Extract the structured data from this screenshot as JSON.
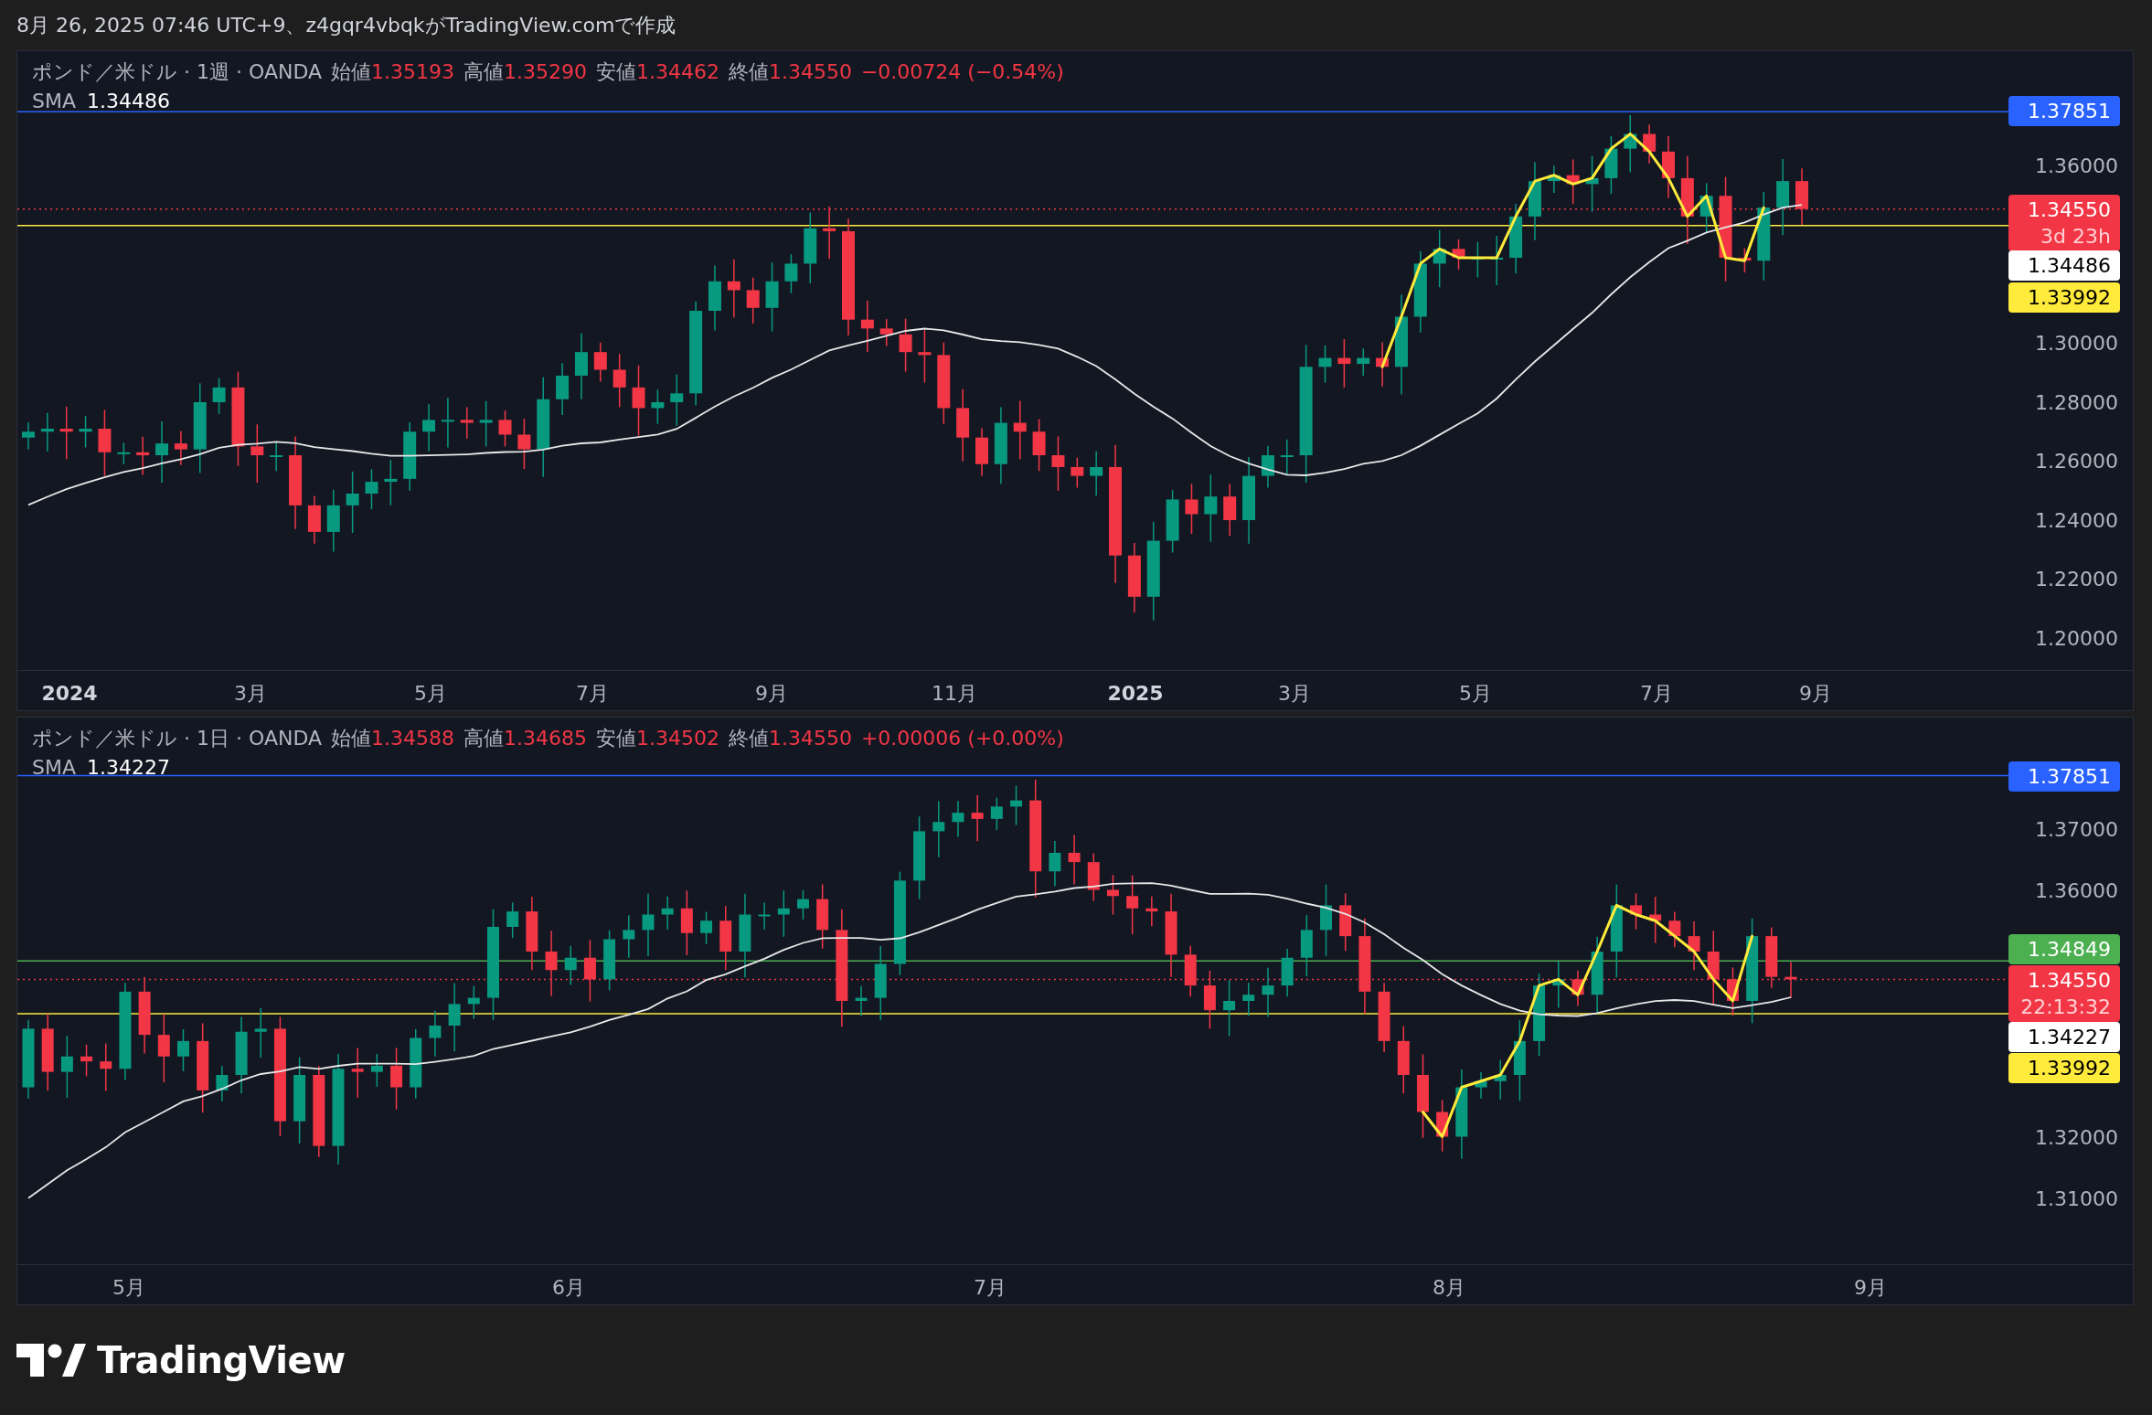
{
  "header": {
    "text": "8月 26, 2025 07:46 UTC+9、z4gqr4vbqkがTradingView.comで作成"
  },
  "panels": [
    {
      "legend": {
        "symbol": "ポンド／米ドル · 1週 · OANDA",
        "fields": [
          {
            "label": "始値",
            "value": "1.35193"
          },
          {
            "label": "高値",
            "value": "1.35290"
          },
          {
            "label": "安値",
            "value": "1.34462"
          },
          {
            "label": "終値",
            "value": "1.34550"
          }
        ],
        "change": "−0.00724 (−0.54%)"
      },
      "indicator": {
        "label": "SMA",
        "value": "1.34486"
      },
      "price_axis": [
        "1.36000",
        "1.30000",
        "1.28000",
        "1.26000",
        "1.24000",
        "1.22000",
        "1.20000"
      ],
      "price_tags": [
        {
          "value": "1.37851",
          "color": "#2962ff"
        },
        {
          "value": "1.34550",
          "sub": "3d 23h",
          "color": "#f23645"
        },
        {
          "value": "1.34486",
          "color": "#ffffff"
        },
        {
          "value": "1.33992",
          "color": "#ffeb3b"
        }
      ],
      "time_axis": [
        {
          "label": "2024",
          "bold": true
        },
        {
          "label": "3月",
          "bold": false
        },
        {
          "label": "5月",
          "bold": false
        },
        {
          "label": "7月",
          "bold": false
        },
        {
          "label": "9月",
          "bold": false
        },
        {
          "label": "11月",
          "bold": false
        },
        {
          "label": "2025",
          "bold": true
        },
        {
          "label": "3月",
          "bold": false
        },
        {
          "label": "5月",
          "bold": false
        },
        {
          "label": "7月",
          "bold": false
        },
        {
          "label": "9月",
          "bold": false
        }
      ]
    },
    {
      "legend": {
        "symbol": "ポンド／米ドル · 1日 · OANDA",
        "fields": [
          {
            "label": "始値",
            "value": "1.34588"
          },
          {
            "label": "高値",
            "value": "1.34685"
          },
          {
            "label": "安値",
            "value": "1.34502"
          },
          {
            "label": "終値",
            "value": "1.34550"
          }
        ],
        "change": "+0.00006 (+0.00%)"
      },
      "indicator": {
        "label": "SMA",
        "value": "1.34227"
      },
      "price_axis": [
        "1.37000",
        "1.36000",
        "1.32000",
        "1.31000"
      ],
      "price_tags": [
        {
          "value": "1.37851",
          "color": "#2962ff"
        },
        {
          "value": "1.34849",
          "color": "#4caf50"
        },
        {
          "value": "1.34550",
          "sub": "22:13:32",
          "color": "#f23645"
        },
        {
          "value": "1.34227",
          "color": "#ffffff"
        },
        {
          "value": "1.33992",
          "color": "#ffeb3b"
        }
      ],
      "time_axis": [
        {
          "label": "5月",
          "bold": false
        },
        {
          "label": "6月",
          "bold": false
        },
        {
          "label": "7月",
          "bold": false
        },
        {
          "label": "8月",
          "bold": false
        },
        {
          "label": "9月",
          "bold": false
        }
      ]
    }
  ],
  "logo": {
    "text": "TradingView"
  }
}
